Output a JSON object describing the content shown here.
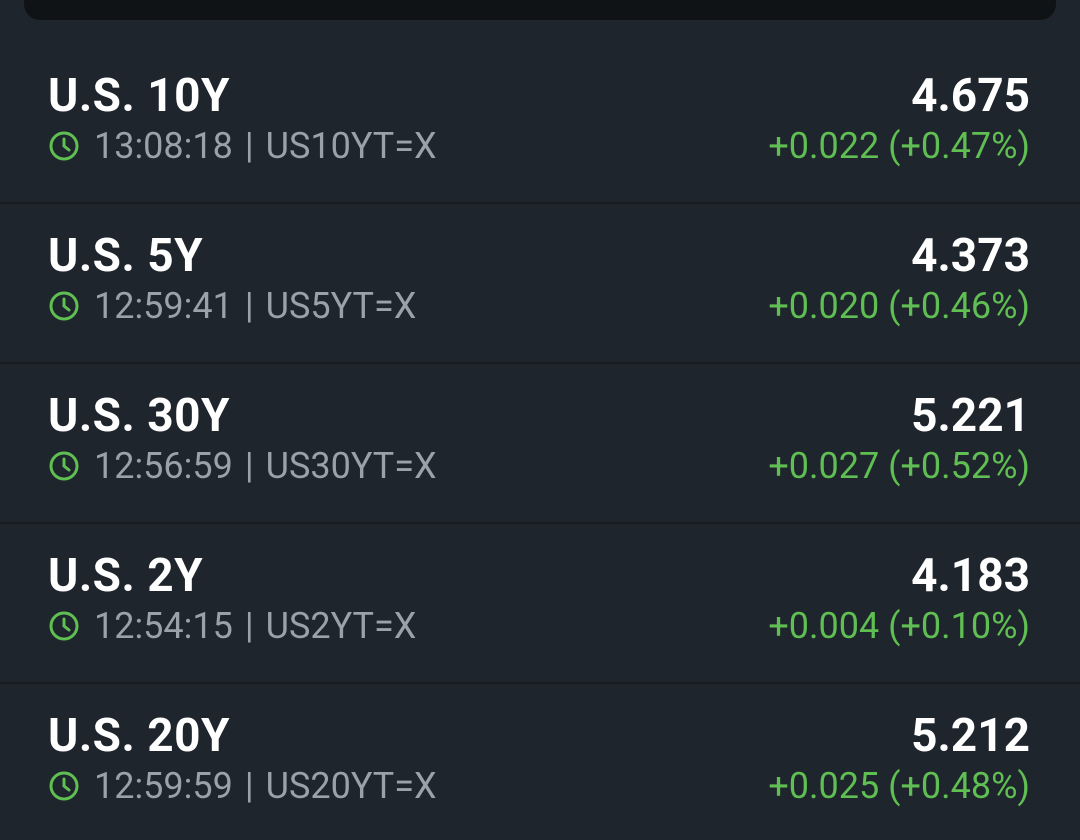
{
  "colors": {
    "background": "#1f252c",
    "positive": "#5fbf52",
    "muted": "#9aa1a8",
    "primary_text": "#ffffff"
  },
  "meta_separator": "|",
  "quotes": [
    {
      "name": "U.S. 10Y",
      "time": "13:08:18",
      "symbol": "US10YT=X",
      "price": "4.675",
      "change": "+0.022 (+0.47%)",
      "icon": "clock-icon"
    },
    {
      "name": "U.S. 5Y",
      "time": "12:59:41",
      "symbol": "US5YT=X",
      "price": "4.373",
      "change": "+0.020 (+0.46%)",
      "icon": "clock-icon"
    },
    {
      "name": "U.S. 30Y",
      "time": "12:56:59",
      "symbol": "US30YT=X",
      "price": "5.221",
      "change": "+0.027 (+0.52%)",
      "icon": "clock-icon"
    },
    {
      "name": "U.S. 2Y",
      "time": "12:54:15",
      "symbol": "US2YT=X",
      "price": "4.183",
      "change": "+0.004 (+0.10%)",
      "icon": "clock-icon"
    },
    {
      "name": "U.S. 20Y",
      "time": "12:59:59",
      "symbol": "US20YT=X",
      "price": "5.212",
      "change": "+0.025 (+0.48%)",
      "icon": "clock-icon"
    }
  ]
}
